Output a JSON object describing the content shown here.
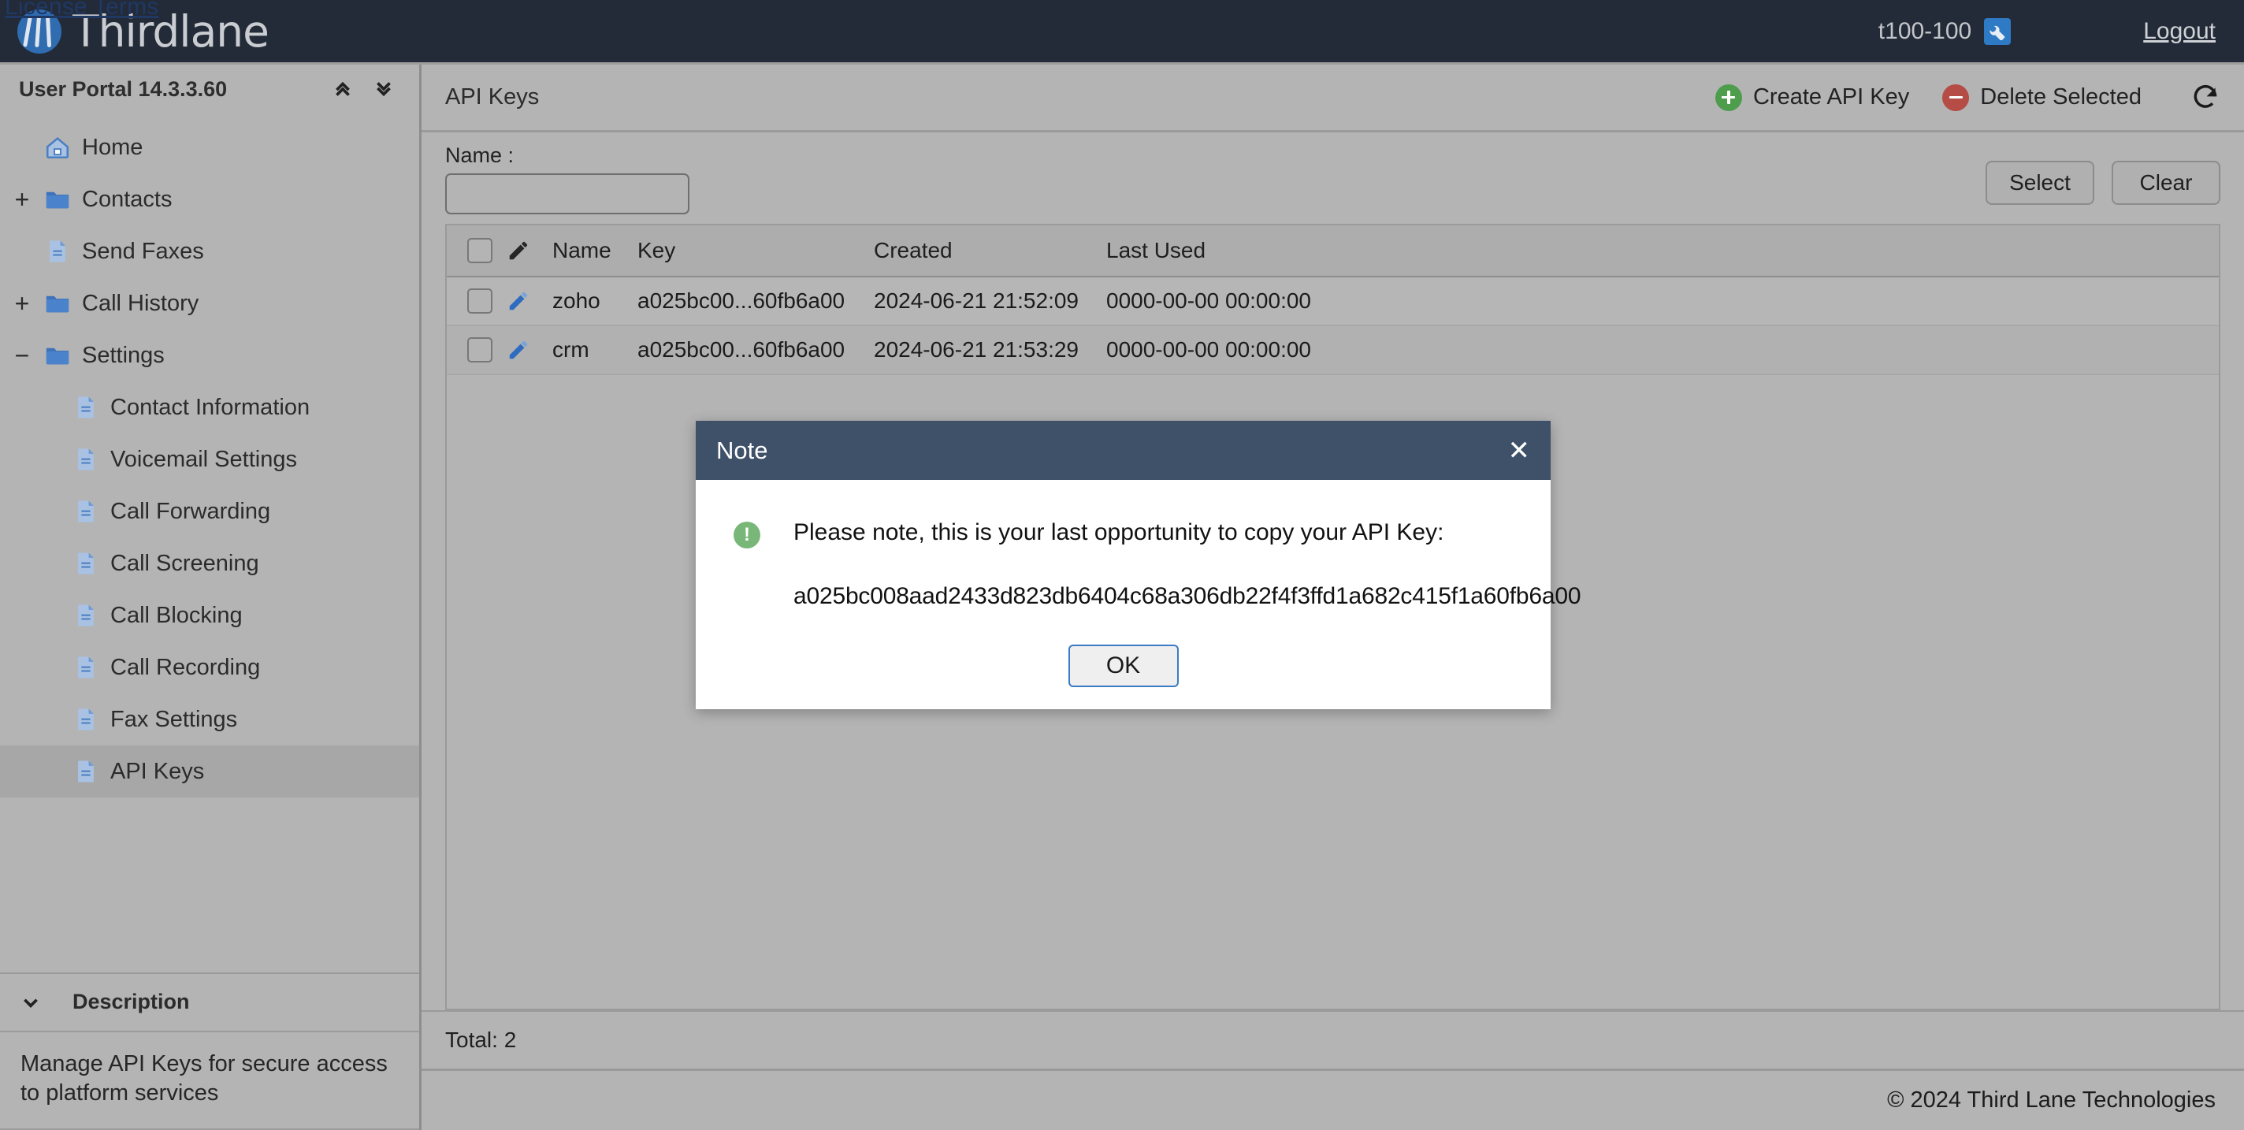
{
  "topbar": {
    "license_link": "License Terms",
    "brand_name": "Thirdlane",
    "account": "t100-100",
    "settings_icon": "wrench-icon",
    "logout": "Logout"
  },
  "sidebar": {
    "title": "User Portal 14.3.3.60",
    "collapse_all_icon": "chevron-double-up-icon",
    "expand_all_icon": "chevron-double-down-icon",
    "items": [
      {
        "label": "Home",
        "icon": "home-icon",
        "toggle": "",
        "indent": 0,
        "selected": false
      },
      {
        "label": "Contacts",
        "icon": "folder-icon",
        "toggle": "+",
        "indent": 0,
        "selected": false
      },
      {
        "label": "Send Faxes",
        "icon": "document-icon",
        "toggle": "",
        "indent": 0,
        "selected": false
      },
      {
        "label": "Call History",
        "icon": "folder-icon",
        "toggle": "+",
        "indent": 0,
        "selected": false
      },
      {
        "label": "Settings",
        "icon": "folder-icon",
        "toggle": "−",
        "indent": 0,
        "selected": false
      },
      {
        "label": "Contact Information",
        "icon": "document-icon",
        "toggle": "",
        "indent": 1,
        "selected": false
      },
      {
        "label": "Voicemail Settings",
        "icon": "document-icon",
        "toggle": "",
        "indent": 1,
        "selected": false
      },
      {
        "label": "Call Forwarding",
        "icon": "document-icon",
        "toggle": "",
        "indent": 1,
        "selected": false
      },
      {
        "label": "Call Screening",
        "icon": "document-icon",
        "toggle": "",
        "indent": 1,
        "selected": false
      },
      {
        "label": "Call Blocking",
        "icon": "document-icon",
        "toggle": "",
        "indent": 1,
        "selected": false
      },
      {
        "label": "Call Recording",
        "icon": "document-icon",
        "toggle": "",
        "indent": 1,
        "selected": false
      },
      {
        "label": "Fax Settings",
        "icon": "document-icon",
        "toggle": "",
        "indent": 1,
        "selected": false
      },
      {
        "label": "API Keys",
        "icon": "document-icon",
        "toggle": "",
        "indent": 1,
        "selected": true
      }
    ],
    "description": {
      "header": "Description",
      "chevron_icon": "chevron-down-icon",
      "text": "Manage API Keys for secure access to platform services"
    }
  },
  "main": {
    "title": "API Keys",
    "create_button": "Create API Key",
    "delete_button": "Delete Selected",
    "refresh_icon": "refresh-icon",
    "filter": {
      "label": "Name :",
      "value": "",
      "placeholder": "",
      "select_button": "Select",
      "clear_button": "Clear"
    },
    "table": {
      "columns": [
        "",
        "",
        "Name",
        "Key",
        "Created",
        "Last Used"
      ],
      "rows": [
        {
          "name": "zoho",
          "key": "a025bc00...60fb6a00",
          "created": "2024-06-21 21:52:09",
          "last_used": "0000-00-00 00:00:00"
        },
        {
          "name": "crm",
          "key": "a025bc00...60fb6a00",
          "created": "2024-06-21 21:53:29",
          "last_used": "0000-00-00 00:00:00"
        }
      ]
    },
    "total": "Total: 2"
  },
  "modal": {
    "title": "Note",
    "close_icon": "close-icon",
    "status_icon": "exclamation-icon",
    "message": "Please note, this is your last opportunity to copy your API Key:",
    "api_key": "a025bc008aad2433d823db6404c68a306db22f4f3ffd1a682c415f1a60fb6a00",
    "ok_button": "OK"
  },
  "footer": {
    "copyright": "© 2024 Third Lane Technologies"
  },
  "colors": {
    "topbar_bg": "#232b38",
    "page_bg": "#b4b4b4",
    "modal_header_bg": "#3f5069",
    "accent_blue": "#2f7ac4",
    "create_green": "#4d9d4d",
    "delete_red": "#b54c45",
    "focus_blue": "#3a7cc4"
  }
}
